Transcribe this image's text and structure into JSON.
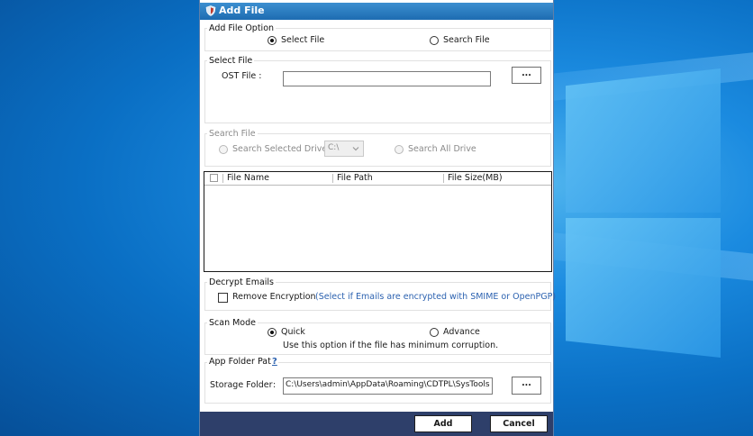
{
  "window": {
    "title": "Add File",
    "title_icon": "shield-icon"
  },
  "add_file_option": {
    "title": "Add File Option",
    "options": [
      {
        "label": "Select File",
        "checked": true
      },
      {
        "label": "Search File",
        "checked": false
      }
    ]
  },
  "select_file": {
    "title": "Select File",
    "ost_label": "OST File :",
    "ost_value": "",
    "browse_label": "..."
  },
  "search_file": {
    "title": "Search File",
    "selected_drive_label": "Search Selected Drive",
    "drive_value": "C:\\",
    "all_drive_label": "Search All Drive"
  },
  "file_table": {
    "columns": [
      "File Name",
      "File Path",
      "File Size(MB)"
    ],
    "rows": []
  },
  "decrypt": {
    "title": "Decrypt Emails",
    "checkbox_label": "Remove Encryption",
    "hint": "(Select if Emails are encrypted with SMIME or OpenPGP)"
  },
  "scan_mode": {
    "title": "Scan Mode",
    "options": [
      {
        "label": "Quick",
        "checked": true
      },
      {
        "label": "Advance",
        "checked": false
      }
    ],
    "description": "Use this option if the file has minimum corruption."
  },
  "app_folder": {
    "title": "App Folder Path",
    "help": "?",
    "storage_label": "Storage Folder",
    "colon": ":",
    "storage_value": "C:\\Users\\admin\\AppData\\Roaming\\CDTPL\\SysTools C",
    "browse_label": "..."
  },
  "footer": {
    "add_label": "Add",
    "cancel_label": "Cancel"
  },
  "colors": {
    "titlebar": "#1d6cb1",
    "footer": "#2e3f6a",
    "hint": "#2c62b0",
    "desktop": "#0a72c8"
  }
}
